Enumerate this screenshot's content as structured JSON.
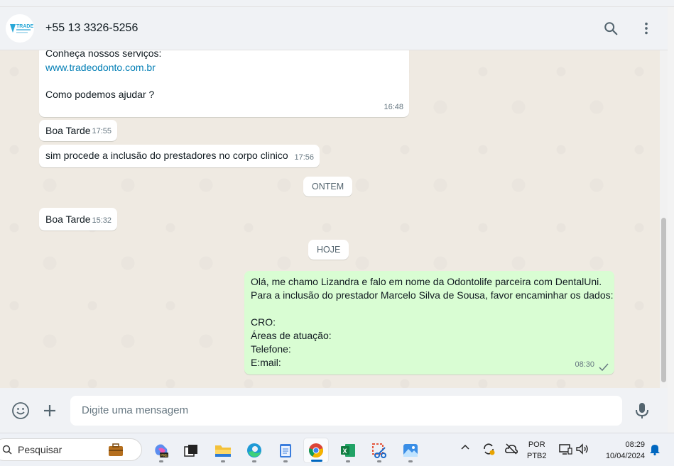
{
  "header": {
    "contact_name": "+55 13 3326-5256",
    "avatar_text": "TRADE"
  },
  "messages": [
    {
      "text_prefix": "Conheça nossos serviços:",
      "link": "www.tradeodonto.com.br",
      "text_suffix": "Como podemos ajudar ?",
      "time": "16:48"
    },
    {
      "text": "Boa Tarde",
      "time": "17:55"
    },
    {
      "text": "sim procede a inclusão do prestadores no corpo clinico",
      "time": "17:56"
    },
    {
      "day": "ONTEM"
    },
    {
      "text": "Boa Tarde",
      "time": "15:32"
    },
    {
      "day": "HOJE"
    },
    {
      "text": "Olá, me chamo Lizandra e falo em nome da Odontolife parceira com DentalUni.\nPara a inclusão do prestador Marcelo Silva de Sousa, favor encaminhar os dados:\n\nCRO:\nÁreas de atuação:\nTelefone:\nE:mail:",
      "time": "08:30"
    }
  ],
  "composer": {
    "placeholder": "Digite uma mensagem"
  },
  "taskbar": {
    "search_label": "Pesquisar",
    "language": "POR",
    "layout": "PTB2",
    "time": "08:29",
    "date": "10/04/2024"
  },
  "colors": {
    "incoming": "#ffffff",
    "outgoing": "#d9fdd3",
    "link": "#027eb5",
    "chat_bg": "#efeae2"
  }
}
